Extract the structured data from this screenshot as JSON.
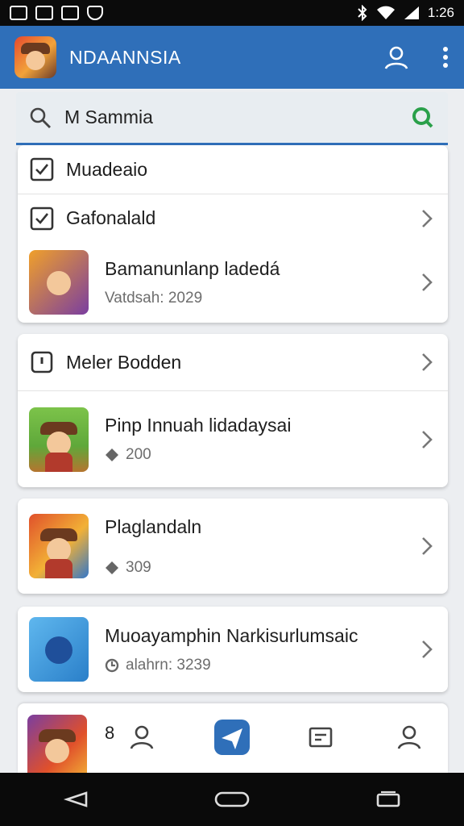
{
  "status_bar": {
    "left_icons": [
      "media-icon",
      "bookmark-icon",
      "image-icon",
      "shield-icon"
    ],
    "right_icons": [
      "bluetooth-icon",
      "wifi-icon",
      "signal-icon"
    ],
    "time": "1:26"
  },
  "app_bar": {
    "title": "NDAANNSIA",
    "actions": [
      "account-icon",
      "more-vert-icon"
    ],
    "background": "#2f6fb9"
  },
  "search": {
    "value": "M Sammia",
    "icon": "search-icon",
    "go_icon": "search-go-icon",
    "go_color": "#2aa04a"
  },
  "card1": {
    "rows": [
      {
        "label": "Muadeaio",
        "icon": "checkbox-icon",
        "chevron": false
      },
      {
        "label": "Gafonalald",
        "icon": "checkbox-icon",
        "chevron": true
      }
    ],
    "app": {
      "title": "Bamanunlanp ladedá",
      "subtitle": "Vatdsah: 2029"
    }
  },
  "card2": {
    "header": {
      "label": "Meler Bodden",
      "icon": "info-box-icon"
    },
    "app": {
      "title": "Pinp Innuah lidadaysai",
      "meta": "200",
      "meta_icon": "diamond-icon"
    }
  },
  "card3": {
    "app": {
      "title": "Plaglandaln",
      "meta": "309",
      "meta_icon": "diamond-icon"
    }
  },
  "card4": {
    "app": {
      "title": "Muoayamphin Narkisurlumsaic",
      "meta": "alahrn: 3239",
      "meta_icon": "clock-icon"
    }
  },
  "bottom_nav": {
    "peek_number": "8",
    "items": [
      "profile-icon",
      "send-icon",
      "ticket-icon",
      "account-icon"
    ],
    "active_color": "#2f6fb9"
  },
  "system_nav": [
    "back-icon",
    "home-icon",
    "recents-icon"
  ]
}
